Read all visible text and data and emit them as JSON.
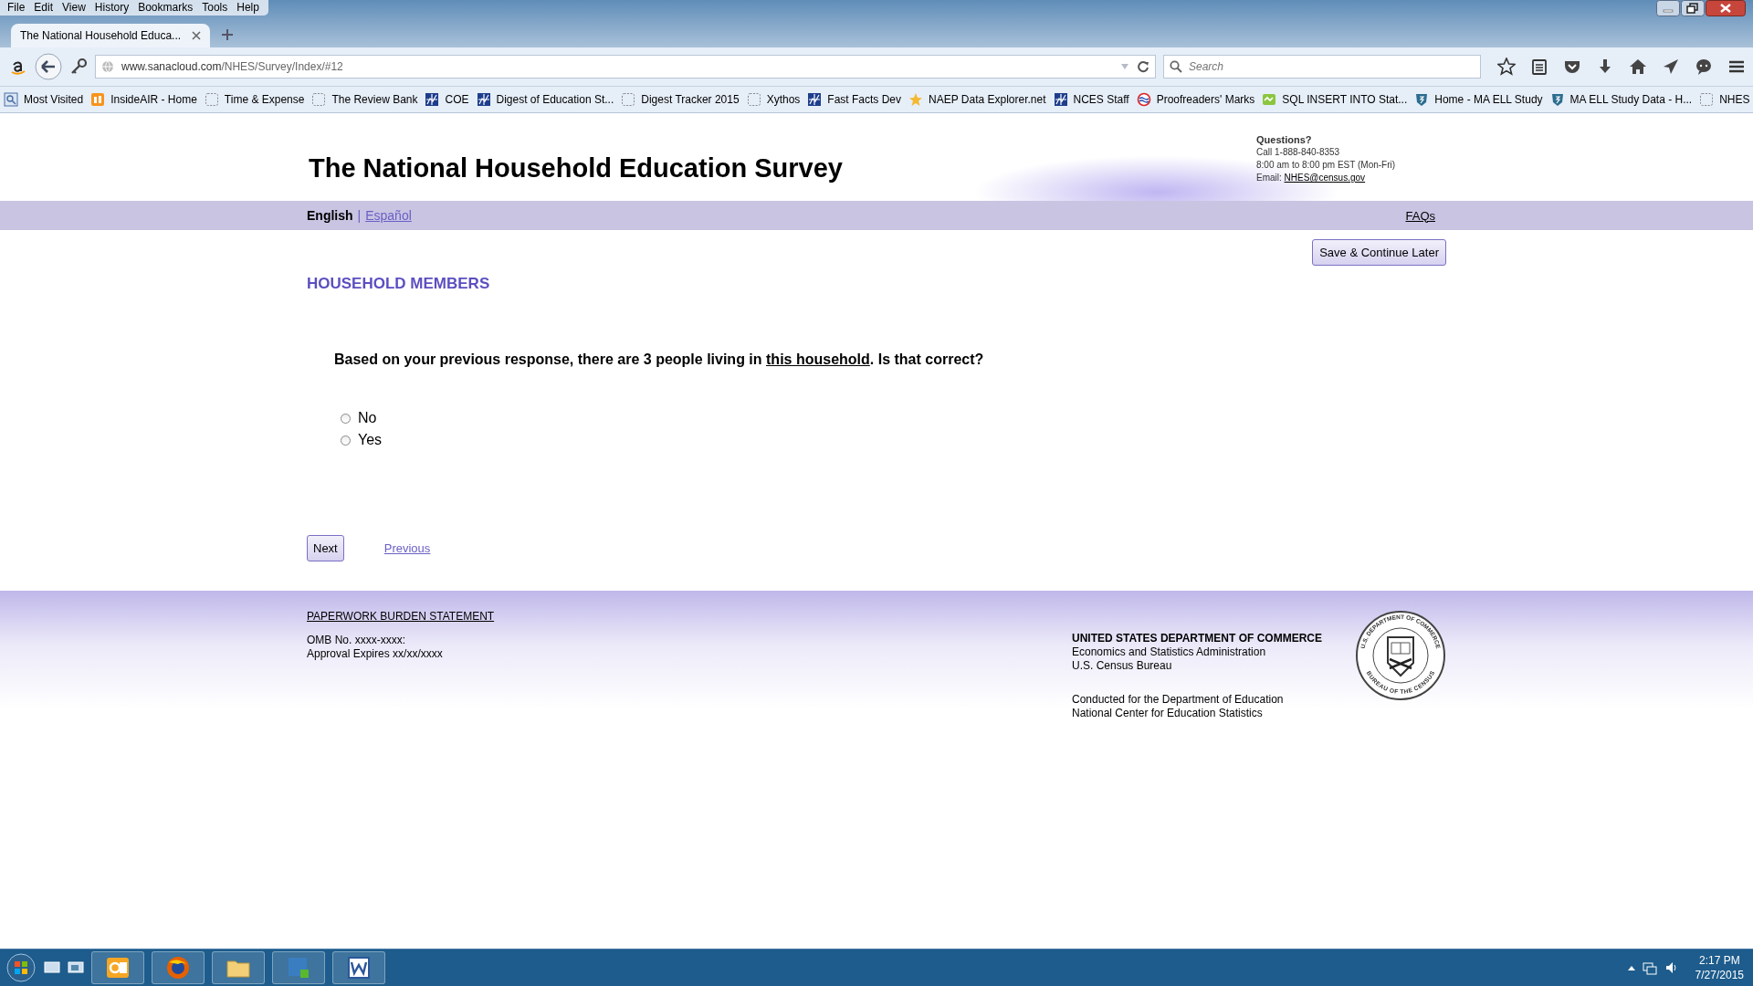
{
  "browser": {
    "menu": [
      "File",
      "Edit",
      "View",
      "History",
      "Bookmarks",
      "Tools",
      "Help"
    ],
    "tabs": [
      {
        "title": "The National Household Educa...",
        "selected": true
      }
    ],
    "url": {
      "host": "www.sanacloud.com",
      "path": "/NHES/Survey/Index/#12"
    },
    "search": {
      "placeholder": "Search"
    },
    "bookmarks": [
      {
        "label": "Most Visited",
        "kind": "folder"
      },
      {
        "label": "InsideAIR - Home",
        "kind": "orange"
      },
      {
        "label": "Time & Expense",
        "kind": "blank"
      },
      {
        "label": "The Review Bank",
        "kind": "blank"
      },
      {
        "label": "COE",
        "kind": "chart"
      },
      {
        "label": "Digest of Education St...",
        "kind": "chart"
      },
      {
        "label": "Digest Tracker 2015",
        "kind": "blank"
      },
      {
        "label": "Xythos",
        "kind": "blank"
      },
      {
        "label": "Fast Facts Dev",
        "kind": "chart"
      },
      {
        "label": "NAEP Data Explorer.net",
        "kind": "star"
      },
      {
        "label": "NCES Staff",
        "kind": "chart"
      },
      {
        "label": "Proofreaders' Marks",
        "kind": "circle"
      },
      {
        "label": "SQL INSERT INTO Stat...",
        "kind": "green"
      },
      {
        "label": "Home - MA ELL Study",
        "kind": "shield"
      },
      {
        "label": "MA ELL Study Data - H...",
        "kind": "shield"
      },
      {
        "label": "NHES",
        "kind": "blank"
      }
    ]
  },
  "survey": {
    "title": "The National Household Education Survey",
    "contact": {
      "heading": "Questions?",
      "lines": [
        "Call 1-888-840-8353",
        "8:00 am to 8:00 pm EST (Mon-Fri)"
      ],
      "email_label": "Email:",
      "email": "NHES@census.gov"
    },
    "languages": [
      {
        "label": "English",
        "selected": true
      },
      {
        "label": "Español",
        "selected": false
      }
    ],
    "separator": "|",
    "faqs": "FAQs",
    "save_button": "Save & Continue Later",
    "section": "HOUSEHOLD MEMBERS",
    "question": {
      "before": "Based on your previous response, there are 3 people living in ",
      "link": "this household",
      "after": ". Is that correct?"
    },
    "options": [
      {
        "label": "No",
        "selected": false
      },
      {
        "label": "Yes",
        "selected": false
      }
    ],
    "next": "Next",
    "previous": "Previous"
  },
  "footer": {
    "paperwork": "PAPERWORK BURDEN STATEMENT",
    "omb": [
      "OMB No. xxxx-xxxx:",
      "Approval Expires xx/xx/xxxx"
    ],
    "agency": [
      "UNITED STATES DEPARTMENT OF COMMERCE",
      "Economics and Statistics Administration",
      "U.S. Census Bureau"
    ],
    "conducted": [
      "Conducted for the Department of Education",
      "National Center for Education Statistics"
    ],
    "seal": {
      "top": "U.S. DEPARTMENT OF COMMERCE",
      "bottom": "BUREAU OF THE CENSUS"
    }
  },
  "taskbar": {
    "apps": [
      {
        "kind": "outlook"
      },
      {
        "kind": "firefox"
      },
      {
        "kind": "explorer"
      },
      {
        "kind": "lync"
      },
      {
        "kind": "word"
      }
    ],
    "time": "2:17 PM",
    "date": "7/27/2015"
  }
}
